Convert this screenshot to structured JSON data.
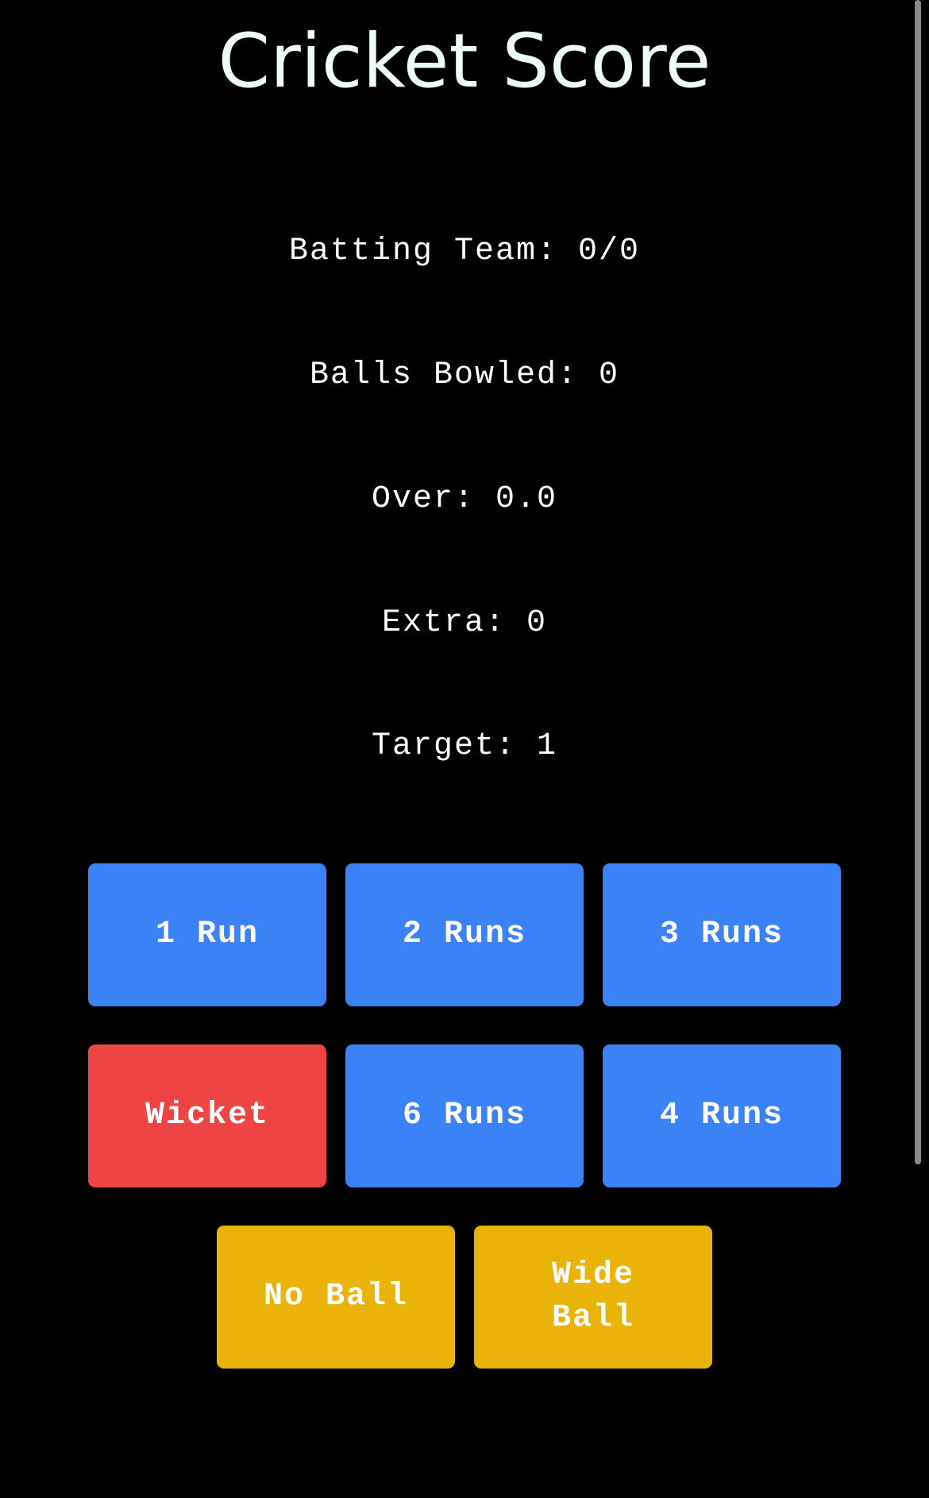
{
  "header": {
    "title": "Cricket Score"
  },
  "stats": {
    "batting_team": "Batting Team: 0/0",
    "balls_bowled": "Balls Bowled: 0",
    "over": "Over: 0.0",
    "extra": "Extra: 0",
    "target": "Target: 1"
  },
  "buttons": {
    "one_run": "1 Run",
    "two_runs": "2 Runs",
    "three_runs": "3 Runs",
    "wicket": "Wicket",
    "six_runs": "6 Runs",
    "four_runs": "4 Runs",
    "no_ball": "No Ball",
    "wide_ball": "Wide Ball"
  },
  "colors": {
    "background": "#000000",
    "run_button": "#3b82f6",
    "wicket_button": "#ef4444",
    "extra_button": "#eab308",
    "text": "#ffffff"
  }
}
